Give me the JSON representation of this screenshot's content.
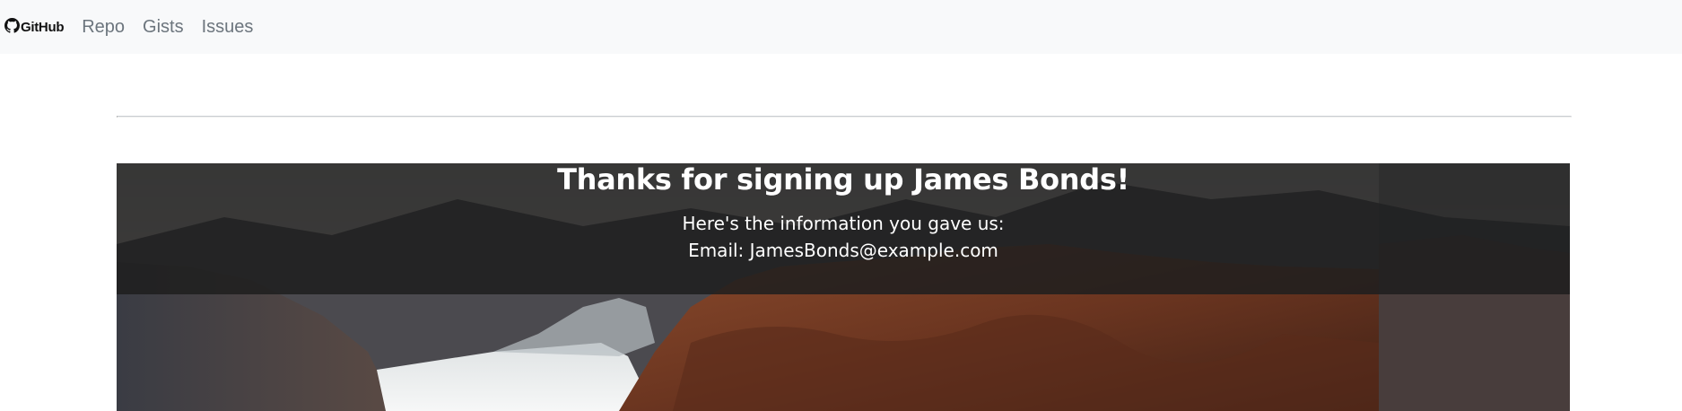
{
  "navbar": {
    "brand": "GitHub",
    "links": [
      "Repo",
      "Gists",
      "Issues"
    ]
  },
  "hero": {
    "title": "Thanks for signing up James Bonds!",
    "info_intro": "Here's the information you gave us:",
    "email_line": "Email: JamesBonds@example.com"
  },
  "colors": {
    "navbar_bg": "#f8f9fa",
    "nav_link": "#6c757d",
    "overlay": "#1e1e1e",
    "overlay_text": "#ffffff"
  },
  "icons": {
    "brand": "github-octocat-icon"
  }
}
